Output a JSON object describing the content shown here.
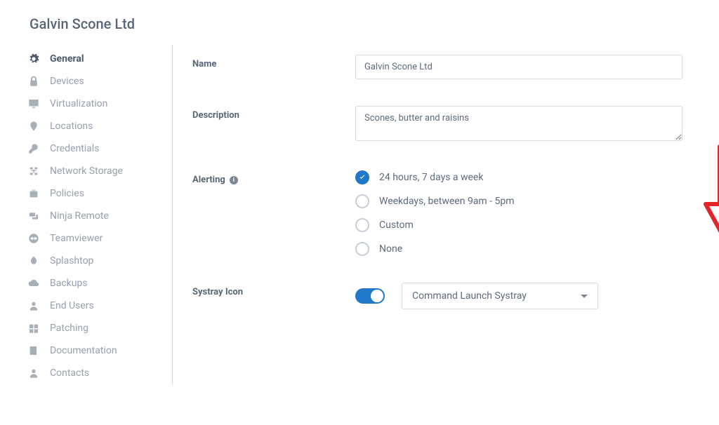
{
  "header": {
    "title": "Galvin Scone Ltd"
  },
  "sidebar": {
    "items": [
      {
        "label": "General",
        "icon": "gear-icon",
        "active": true
      },
      {
        "label": "Devices",
        "icon": "lock-icon"
      },
      {
        "label": "Virtualization",
        "icon": "monitor-icon"
      },
      {
        "label": "Locations",
        "icon": "pin-icon"
      },
      {
        "label": "Credentials",
        "icon": "key-icon"
      },
      {
        "label": "Network Storage",
        "icon": "network-icon"
      },
      {
        "label": "Policies",
        "icon": "briefcase-icon"
      },
      {
        "label": "Ninja Remote",
        "icon": "remote-icon"
      },
      {
        "label": "Teamviewer",
        "icon": "teamviewer-icon"
      },
      {
        "label": "Splashtop",
        "icon": "splashtop-icon"
      },
      {
        "label": "Backups",
        "icon": "cloud-icon"
      },
      {
        "label": "End Users",
        "icon": "person-icon"
      },
      {
        "label": "Patching",
        "icon": "windows-icon"
      },
      {
        "label": "Documentation",
        "icon": "book-icon"
      },
      {
        "label": "Contacts",
        "icon": "person-icon"
      }
    ]
  },
  "form": {
    "name": {
      "label": "Name",
      "value": "Galvin Scone Ltd"
    },
    "description": {
      "label": "Description",
      "value": "Scones, butter and raisins"
    },
    "alerting": {
      "label": "Alerting",
      "options": [
        "24 hours, 7 days a week",
        "Weekdays, between 9am - 5pm",
        "Custom",
        "None"
      ],
      "selected_index": 0
    },
    "systray": {
      "label": "Systray Icon",
      "enabled": true,
      "selected": "Command Launch Systray"
    }
  }
}
